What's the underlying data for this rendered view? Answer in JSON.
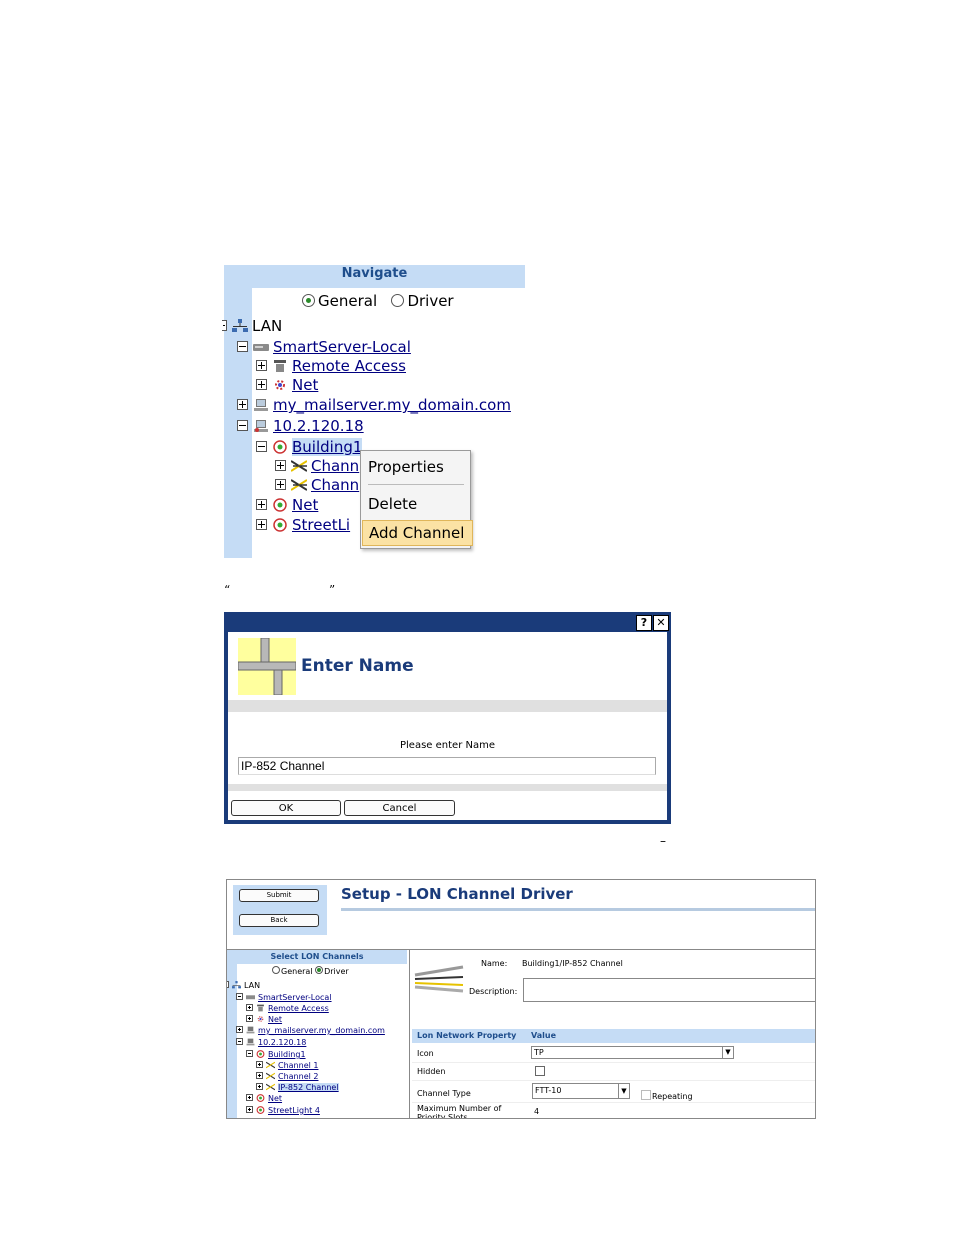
{
  "navigate": {
    "header": "Navigate",
    "radio_general": "General",
    "radio_driver": "Driver",
    "tree": {
      "lan": "LAN",
      "smartserver_local": "SmartServer-Local",
      "remote_access": "Remote Access",
      "net": "Net",
      "mailserver": "my_mailserver.my_domain.com",
      "ip_node": "10.2.120.18",
      "building1": "Building1",
      "channel_a": "Chann",
      "channel_b": "Chann",
      "net2": "Net",
      "streetlight": "StreetLi"
    },
    "context_menu": {
      "properties": "Properties",
      "delete": "Delete",
      "add_channel": "Add Channel"
    }
  },
  "caption": {
    "open_quote": "“",
    "close_quote": "”",
    "dash": "–"
  },
  "dialog": {
    "help": "?",
    "close": "✕",
    "title": "Enter Name",
    "prompt": "Please enter Name",
    "input_value": "IP-852 Channel",
    "ok": "OK",
    "cancel": "Cancel"
  },
  "setup": {
    "submit": "Submit",
    "back": "Back",
    "title": "Setup - LON Channel Driver",
    "tree_header": "Select LON Channels",
    "radio_general": "General",
    "radio_driver": "Driver",
    "tree": {
      "lan": "LAN",
      "smartserver_local": "SmartServer-Local",
      "remote_access": "Remote Access",
      "net": "Net",
      "mailserver": "my_mailserver.my_domain.com",
      "ip_node": "10.2.120.18",
      "building1": "Building1",
      "channel1": "Channel 1",
      "channel2": "Channel 2",
      "ip852": "IP-852 Channel",
      "net2": "Net",
      "streetlight4": "StreetLight 4"
    },
    "name_label": "Name:",
    "name_value": "Building1/IP-852 Channel",
    "description_label": "Description:",
    "grid": {
      "col1": "Lon Network Property",
      "col2": "Value",
      "icon_label": "Icon",
      "icon_value": "TP",
      "hidden_label": "Hidden",
      "channel_type_label": "Channel Type",
      "channel_type_value": "FTT-10",
      "repeating_label": "Repeating",
      "max_priority_label": "Maximum Number of Priority Slots",
      "max_priority_value": "4"
    }
  }
}
